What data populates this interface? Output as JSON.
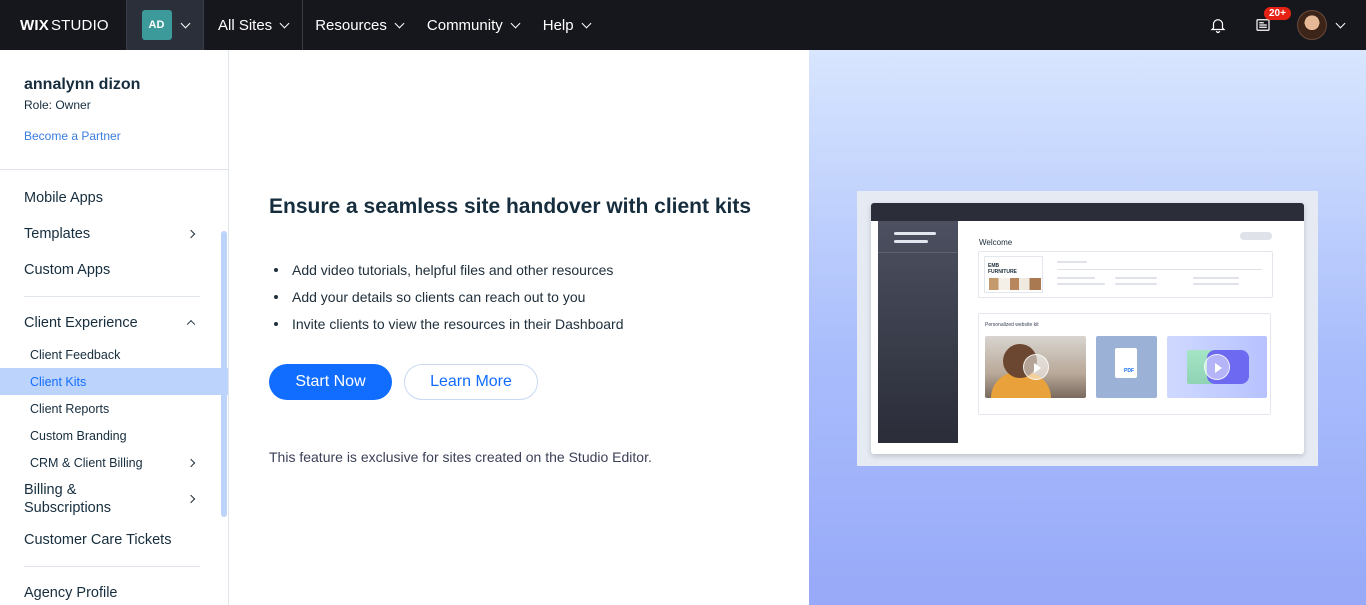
{
  "topbar": {
    "logo_bold": "WIX",
    "logo_light": "STUDIO",
    "site_initials": "AD",
    "nav": [
      "All Sites",
      "Resources",
      "Community",
      "Help"
    ],
    "notifications_badge": "20+"
  },
  "sidebar": {
    "user_name": "annalynn dizon",
    "user_role": "Role: Owner",
    "partner_link": "Become a Partner",
    "items": {
      "mobile_apps": "Mobile Apps",
      "templates": "Templates",
      "custom_apps": "Custom Apps",
      "client_experience": "Client Experience",
      "client_feedback": "Client Feedback",
      "client_kits": "Client Kits",
      "client_reports": "Client Reports",
      "custom_branding": "Custom Branding",
      "crm_billing": "CRM & Client Billing",
      "billing_subscriptions_1": "Billing &",
      "billing_subscriptions_2": "Subscriptions",
      "customer_care": "Customer Care Tickets",
      "agency_profile": "Agency Profile"
    }
  },
  "main": {
    "headline": "Ensure a seamless site handover with client kits",
    "bullets": [
      "Add video tutorials, helpful files and other resources",
      "Add your details so clients can reach out to you",
      "Invite clients to view the resources in their Dashboard"
    ],
    "start_button": "Start Now",
    "learn_button": "Learn More",
    "note": "This feature is exclusive for sites created on the Studio Editor."
  },
  "illustration": {
    "welcome": "Welcome",
    "brand_line1": "EMB",
    "brand_line2": "FURNITURE",
    "kit_label": "Personalized website kit"
  },
  "colors": {
    "primary": "#116dff",
    "topbar": "#16161d",
    "active_item": "#bcd4fb",
    "badge": "#e62214"
  }
}
